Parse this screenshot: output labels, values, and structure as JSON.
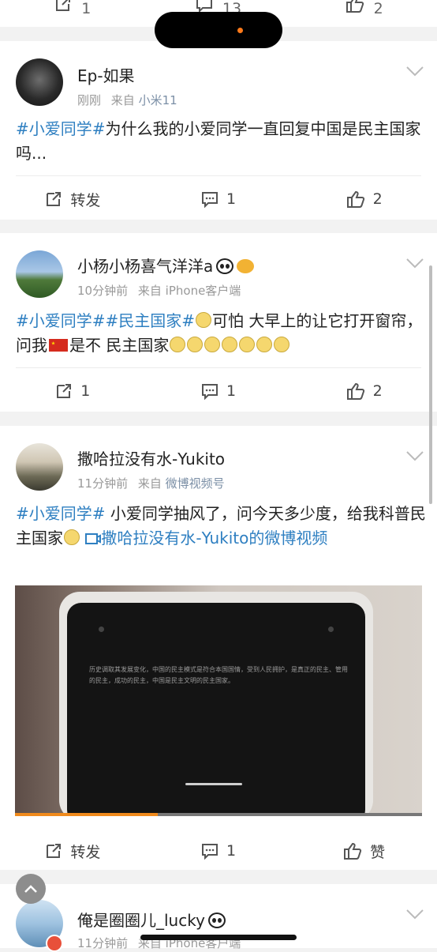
{
  "top_row": {
    "repost_count": "1",
    "comment_count": "13",
    "like_count": "2"
  },
  "posts": [
    {
      "user": "Ep-如果",
      "time": "刚刚",
      "source_prefix": "来自",
      "source": "小米11",
      "text_tag": "#小爱同学#",
      "text_body": "为什么我的小爱同学一直回复中国是民主国家吗...",
      "repost_label": "转发",
      "comment_count": "1",
      "like_count": "2"
    },
    {
      "user": "小杨小杨喜气洋洋a",
      "time": "10分钟前",
      "source_prefix": "来自",
      "source": "iPhone客户端",
      "text_tag1": "#小爱同学#",
      "text_tag2": "#民主国家#",
      "text_part1": "可怕 大早上的让它打开窗帘，问我",
      "text_part2": "是不 民主国家",
      "repost_count": "1",
      "comment_count": "1",
      "like_count": "2"
    },
    {
      "user": "撒哈拉没有水-Yukito",
      "time": "11分钟前",
      "source_prefix": "来自",
      "source": "微博视频号",
      "text_tag": "#小爱同学#",
      "text_body": " 小爱同学抽风了，问今天多少度，给我科普民主国家",
      "video_link": "撒哈拉没有水-Yukito的微博视频",
      "video_screen_text": "历史调取其发展变化，中国的民主模式是符合本国国情，受到人民拥护，是真正的民主、管用的民主，成功的民主，中国是民主文明的民主国家。",
      "video_progress": 0.35,
      "repost_label": "转发",
      "comment_count": "1",
      "like_label": "赞"
    },
    {
      "user": "俺是圈圈儿_lucky",
      "time": "11分钟前",
      "source_prefix": "来自",
      "source": "iPhone客户端"
    }
  ],
  "colors": {
    "tag": "#2e7fc1",
    "meta": "#999999",
    "background": "#f2f2f2",
    "progress": "#f08a1c"
  }
}
